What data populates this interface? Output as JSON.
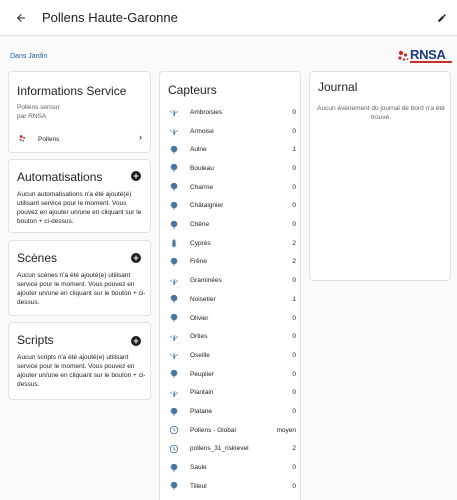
{
  "header": {
    "title": "Pollens Haute-Garonne",
    "back_icon": "arrow-left-icon",
    "edit_icon": "pencil-icon"
  },
  "area": "Dans Jardin",
  "logo": {
    "text": "RNSA",
    "colors": {
      "mark": "#c9302c",
      "text": "#1b3c84"
    }
  },
  "info": {
    "title": "Informations Service",
    "model": "Pollens sensor",
    "manufacturer": "par RNSA",
    "integration_label": "Pollens"
  },
  "automations": {
    "title": "Automatisations",
    "text": "Aucun automatisations n'a été ajouté(e) utilisant service pour le moment. Vous pouvez en ajouter un/une en cliquant sur le bouton + ci-dessus."
  },
  "scenes": {
    "title": "Scènes",
    "text": "Aucun scènes n'a été ajouté(e) utilisant service pour le moment. Vous pouvez en ajouter un/une en cliquant sur le bouton + ci-dessus."
  },
  "scripts": {
    "title": "Scripts",
    "text": "Aucun scripts n'a été ajouté(e) utilisant service pour le moment. Vous pouvez en ajouter un/une en cliquant sur le bouton + ci-dessus."
  },
  "sensors": {
    "title": "Capteurs",
    "items": [
      {
        "name": "Ambroisies",
        "value": "0",
        "icon": "flower-icon"
      },
      {
        "name": "Armoise",
        "value": "0",
        "icon": "flower-icon"
      },
      {
        "name": "Aulne",
        "value": "1",
        "icon": "leaf-tree-icon"
      },
      {
        "name": "Bouleau",
        "value": "0",
        "icon": "leaf-tree-icon"
      },
      {
        "name": "Charme",
        "value": "0",
        "icon": "leaf-tree-icon"
      },
      {
        "name": "Châtaignier",
        "value": "0",
        "icon": "leaf-tree-icon"
      },
      {
        "name": "Chêne",
        "value": "0",
        "icon": "leaf-tree-icon"
      },
      {
        "name": "Cyprès",
        "value": "2",
        "icon": "pine-tree-icon"
      },
      {
        "name": "Frêne",
        "value": "2",
        "icon": "leaf-tree-icon"
      },
      {
        "name": "Graminées",
        "value": "0",
        "icon": "flower-icon"
      },
      {
        "name": "Noisetier",
        "value": "1",
        "icon": "leaf-tree-icon"
      },
      {
        "name": "Olivier",
        "value": "0",
        "icon": "leaf-tree-icon"
      },
      {
        "name": "Orties",
        "value": "0",
        "icon": "flower-icon"
      },
      {
        "name": "Oseille",
        "value": "0",
        "icon": "flower-icon"
      },
      {
        "name": "Peuplier",
        "value": "0",
        "icon": "leaf-tree-icon"
      },
      {
        "name": "Plantain",
        "value": "0",
        "icon": "flower-icon"
      },
      {
        "name": "Platane",
        "value": "0",
        "icon": "leaf-tree-icon"
      },
      {
        "name": "Pollens - Global",
        "value": "moyen",
        "icon": "alert-circle-icon"
      },
      {
        "name": "pollens_31_risklevel",
        "value": "2",
        "icon": "alert-circle-icon"
      },
      {
        "name": "Saule",
        "value": "0",
        "icon": "leaf-tree-icon"
      },
      {
        "name": "Tilleul",
        "value": "0",
        "icon": "leaf-tree-icon"
      }
    ]
  },
  "journal": {
    "title": "Journal",
    "text": "Aucun évènement du journal de bord n'a été trouvé."
  },
  "colors": {
    "icon": "#44739e",
    "accent": "#1f5fa0"
  }
}
